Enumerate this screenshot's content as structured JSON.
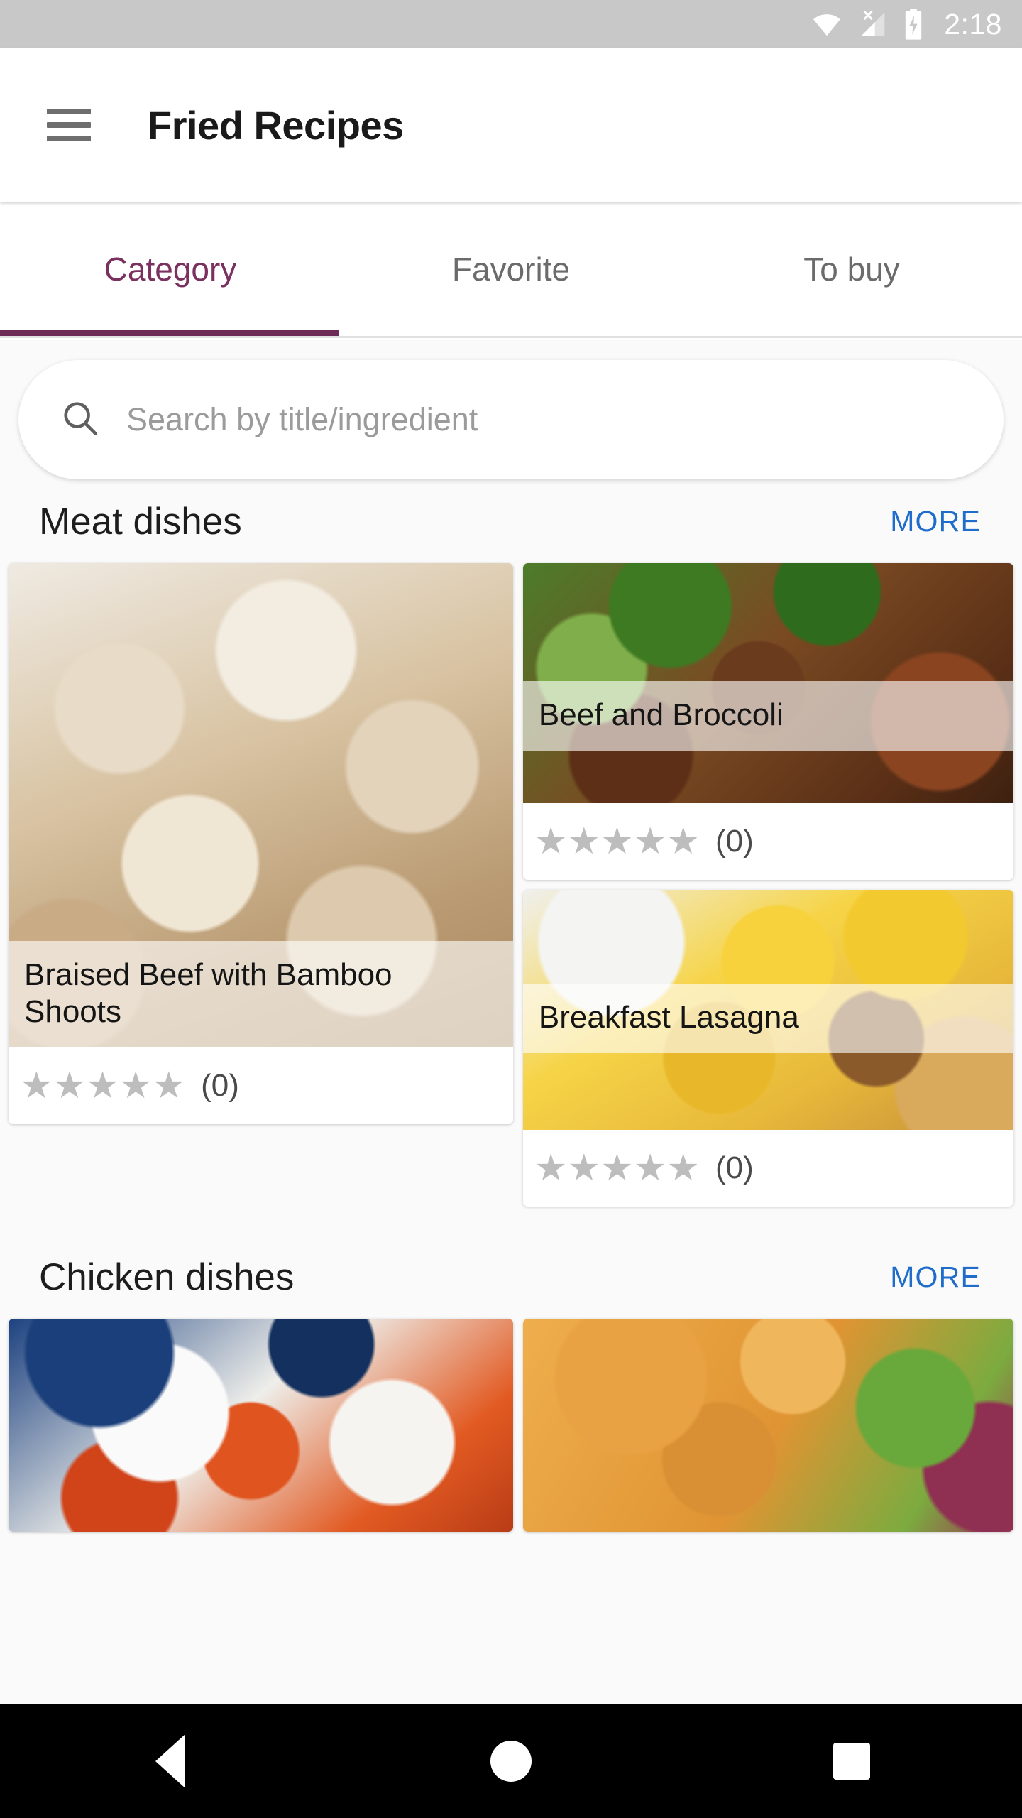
{
  "statusbar": {
    "time": "2:18",
    "icons": [
      "wifi-icon",
      "signal-no-sim-icon",
      "battery-charging-icon"
    ]
  },
  "appbar": {
    "menu_icon": "hamburger-menu-icon",
    "title": "Fried Recipes"
  },
  "tabs": {
    "items": [
      {
        "label": "Category",
        "active": true
      },
      {
        "label": "Favorite",
        "active": false
      },
      {
        "label": "To buy",
        "active": false
      }
    ],
    "active_color": "#7b3160",
    "indicator_color": "#6d2a56",
    "inactive_color": "#6b6b6b"
  },
  "search": {
    "icon": "search-icon",
    "placeholder": "Search by title/ingredient",
    "value": ""
  },
  "more_link_color": "#1f6ccb",
  "sections": [
    {
      "title": "Meat dishes",
      "more_label": "MORE",
      "left_column": [
        {
          "title": "Braised Beef with Bamboo Shoots",
          "stars": "★★★★★",
          "rating_count": "(0)",
          "image_alt": "braised-beef-bamboo-shoots-photo"
        }
      ],
      "right_column": [
        {
          "title": "Beef and Broccoli",
          "stars": "★★★★★",
          "rating_count": "(0)",
          "image_alt": "beef-and-broccoli-photo"
        },
        {
          "title": "Breakfast Lasagna",
          "stars": "★★★★★",
          "rating_count": "(0)",
          "image_alt": "breakfast-lasagna-photo"
        }
      ]
    },
    {
      "title": "Chicken dishes",
      "more_label": "MORE",
      "left_column": [
        {
          "title": "",
          "stars": "",
          "rating_count": "",
          "image_alt": "chicken-with-rice-photo"
        }
      ],
      "right_column": [
        {
          "title": "",
          "stars": "",
          "rating_count": "",
          "image_alt": "fried-chicken-salad-photo"
        }
      ]
    }
  ],
  "navbar": {
    "back": "back-triangle-icon",
    "home": "home-circle-icon",
    "recents": "recents-square-icon"
  }
}
